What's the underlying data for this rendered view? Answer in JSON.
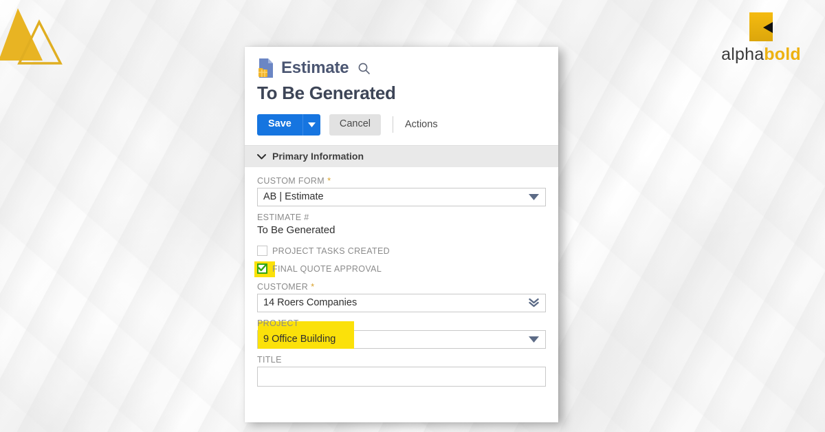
{
  "branding": {
    "logo_mark_name": "alphabold-logo-mark",
    "word_alpha": "alpha",
    "word_bold": "bold",
    "gold": "#edb211",
    "dark": "#3b3b3b"
  },
  "decoration": {
    "triangles_name": "gold-triangles-decoration",
    "gold": "#e0ae21"
  },
  "record": {
    "type_label": "Estimate",
    "type_icon": "estimate-document-icon",
    "search_icon": "search-icon",
    "name": "To Be Generated"
  },
  "toolbar": {
    "save_label": "Save",
    "save_caret_icon": "caret-down-icon",
    "cancel_label": "Cancel",
    "actions_label": "Actions",
    "save_color": "#1675e0"
  },
  "section": {
    "collapse_icon": "chevron-down-icon",
    "title": "Primary Information"
  },
  "fields": {
    "custom_form": {
      "label": "CUSTOM FORM",
      "required": "*",
      "value": "AB | Estimate",
      "icon": "dropdown-triangle-icon"
    },
    "estimate_number": {
      "label": "ESTIMATE #",
      "value": "To Be Generated"
    },
    "project_tasks_created": {
      "label": "PROJECT TASKS CREATED",
      "checked": false
    },
    "final_quote_approval": {
      "label": "FINAL QUOTE APPROVAL",
      "checked": true,
      "highlight_color": "#fbe10a",
      "check_color": "#34a513"
    },
    "customer": {
      "label": "CUSTOMER",
      "required": "*",
      "value": "14 Roers Companies",
      "icon": "double-chevron-down-icon"
    },
    "project": {
      "label": "PROJECT",
      "value": "9 Office Building",
      "icon": "dropdown-triangle-icon",
      "highlight_color": "#fbe10a"
    },
    "title": {
      "label": "TITLE",
      "value": "",
      "placeholder": ""
    }
  }
}
